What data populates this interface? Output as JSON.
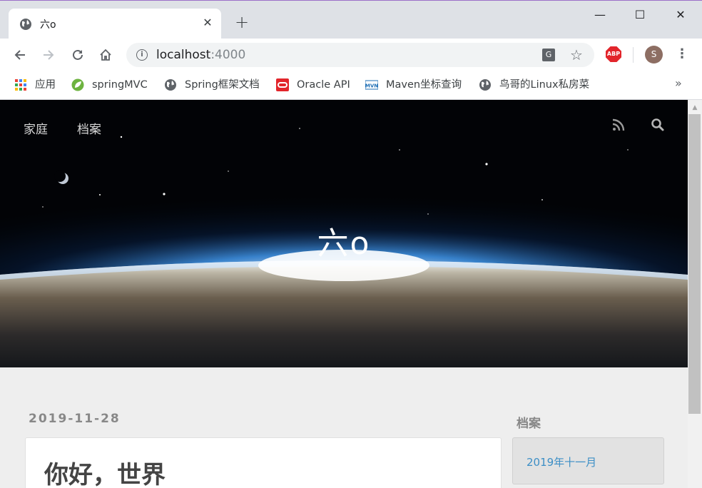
{
  "browser": {
    "tab_title": "六o",
    "new_tab_label": "+",
    "window_controls": {
      "minimize": "—",
      "maximize": "☐",
      "close": "✕"
    },
    "url_host": "localhost",
    "url_port": ":4000",
    "avatar_letter": "S",
    "abp_label": "ABP",
    "bookmarks": [
      {
        "label": "应用",
        "icon": "apps-grid-icon"
      },
      {
        "label": "springMVC",
        "icon": "spring-leaf-icon"
      },
      {
        "label": "Spring框架文档",
        "icon": "globe-icon"
      },
      {
        "label": "Oracle API",
        "icon": "oracle-icon"
      },
      {
        "label": "Maven坐标查询",
        "icon": "maven-icon"
      },
      {
        "label": "鸟哥的Linux私房菜",
        "icon": "globe-icon"
      }
    ],
    "bookmarks_more": "»"
  },
  "site": {
    "nav": {
      "home": "家庭",
      "archive": "档案"
    },
    "title": "六o",
    "post": {
      "date": "2019-11-28",
      "title": "你好，世界"
    },
    "sidebar": {
      "heading": "档案",
      "items": [
        "2019年十一月"
      ]
    }
  },
  "colors": {
    "link": "#3d8fc6",
    "abp": "#e2252b",
    "avatar": "#8d6e63"
  }
}
